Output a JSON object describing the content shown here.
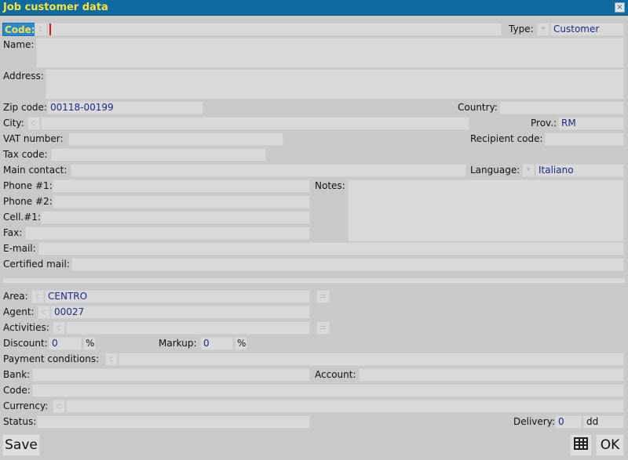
{
  "window": {
    "title": "Job customer data",
    "close_glyph": "×"
  },
  "glyphs": {
    "c": "c",
    "dropdown": "▾"
  },
  "fields": {
    "code": {
      "label": "Code:",
      "value": ""
    },
    "type": {
      "label": "Type:",
      "value": "Customer"
    },
    "name": {
      "label": "Name:",
      "value": ""
    },
    "address": {
      "label": "Address:",
      "value": ""
    },
    "zip": {
      "label": "Zip code:",
      "value": "00118-00199"
    },
    "country": {
      "label": "Country:",
      "value": ""
    },
    "city": {
      "label": "City:",
      "value": ""
    },
    "prov": {
      "label": "Prov.:",
      "value": "RM"
    },
    "vat": {
      "label": "VAT number:",
      "value": ""
    },
    "recipient": {
      "label": "Recipient code:",
      "value": ""
    },
    "tax": {
      "label": "Tax code:",
      "value": ""
    },
    "main_contact": {
      "label": "Main contact:",
      "value": ""
    },
    "language": {
      "label": "Language:",
      "value": "Italiano"
    },
    "phone1": {
      "label": "Phone #1:",
      "value": ""
    },
    "phone2": {
      "label": "Phone #2:",
      "value": ""
    },
    "cell1": {
      "label": "Cell.#1:",
      "value": ""
    },
    "fax": {
      "label": "Fax:",
      "value": ""
    },
    "notes": {
      "label": "Notes:",
      "value": ""
    },
    "email": {
      "label": "E-mail:",
      "value": ""
    },
    "certified_mail": {
      "label": "Certified mail:",
      "value": ""
    },
    "area": {
      "label": "Area:",
      "value": "CENTRO"
    },
    "agent": {
      "label": "Agent:",
      "value": "00027"
    },
    "activities": {
      "label": "Activities:",
      "value": ""
    },
    "discount": {
      "label": "Discount:",
      "value": "0",
      "unit": "%"
    },
    "markup": {
      "label": "Markup:",
      "value": "0",
      "unit": "%"
    },
    "payment": {
      "label": "Payment conditions:",
      "value": ""
    },
    "bank": {
      "label": "Bank:",
      "value": ""
    },
    "account": {
      "label": "Account:",
      "value": ""
    },
    "bank_code": {
      "label": "Code:",
      "value": ""
    },
    "currency": {
      "label": "Currency:",
      "value": ""
    },
    "status": {
      "label": "Status:",
      "value": ""
    },
    "delivery": {
      "label": "Delivery:",
      "value": "0",
      "unit": "dd"
    }
  },
  "footer": {
    "save_label": "Save",
    "ok_label": "OK",
    "grid_icon": "grid-icon"
  }
}
